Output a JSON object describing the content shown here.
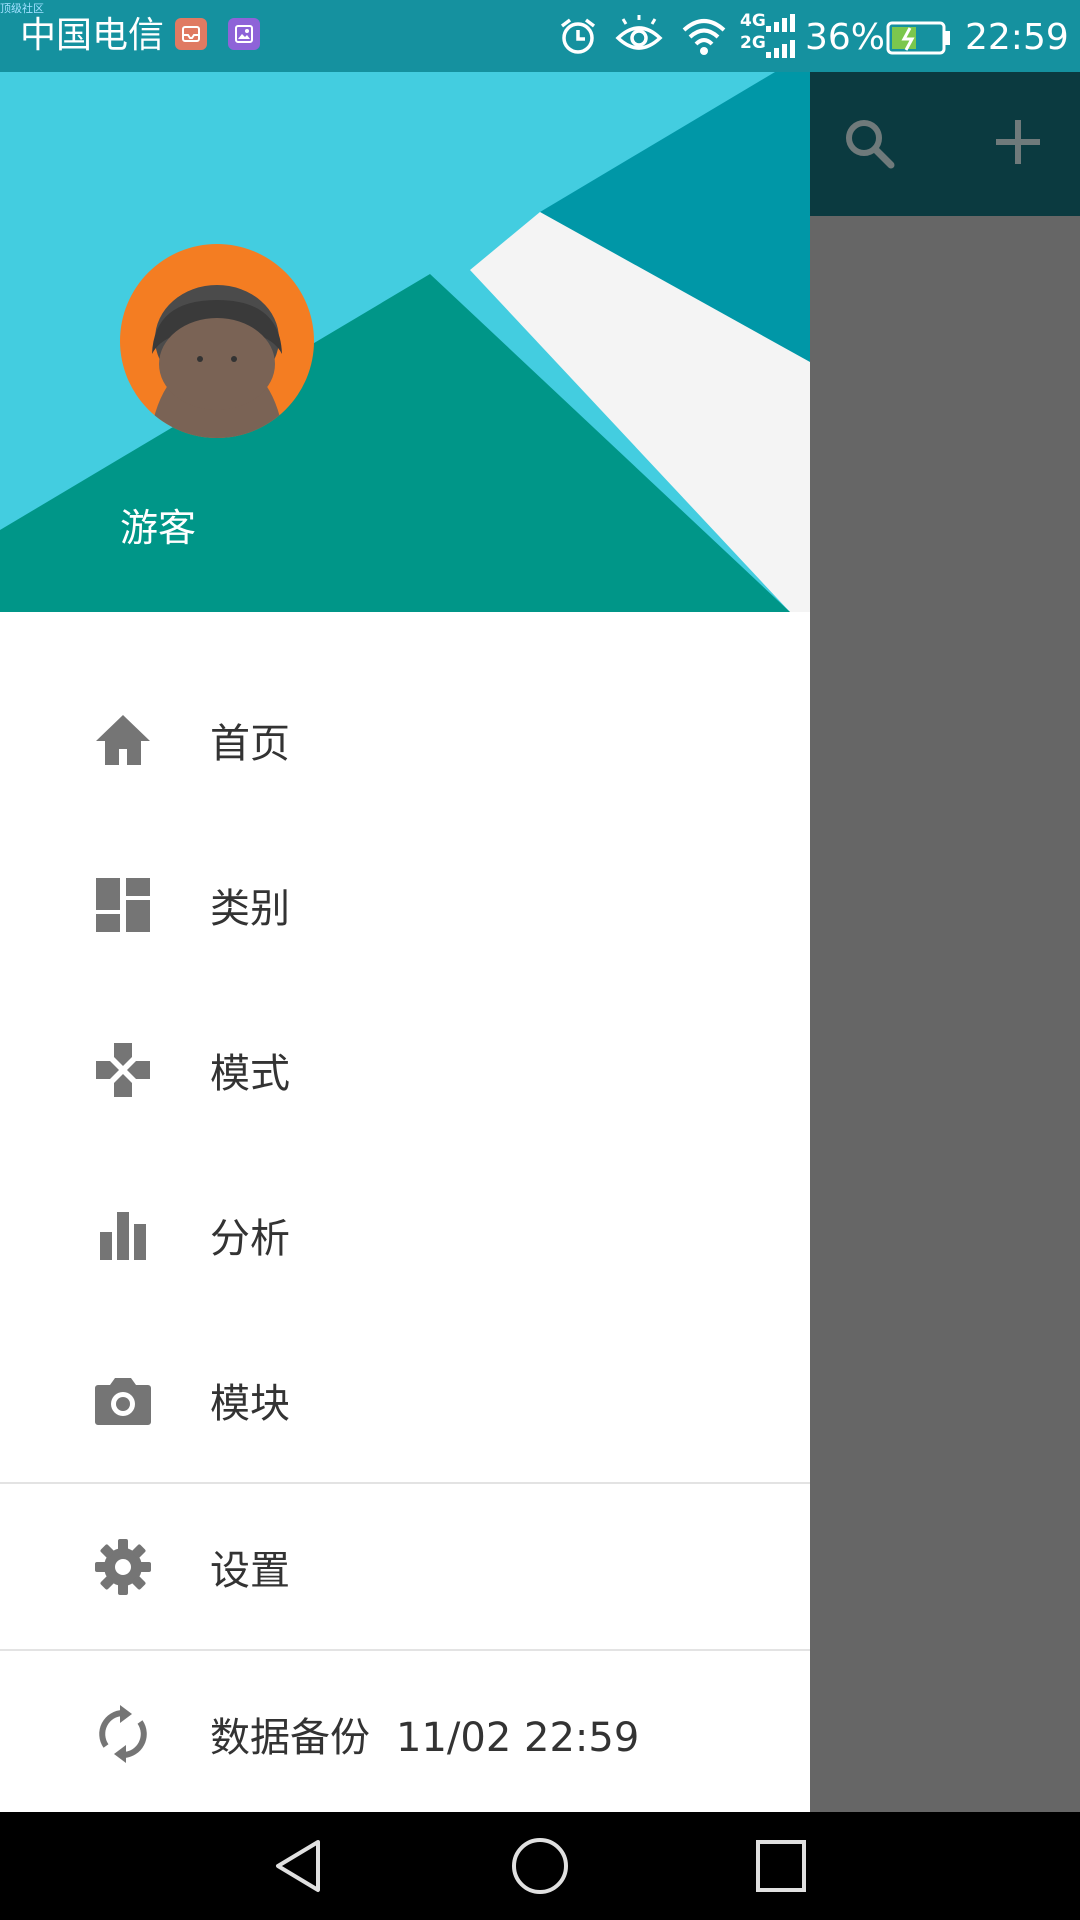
{
  "status_bar": {
    "tiny_tag": "顶级社区",
    "carrier": "中国电信",
    "network_top": "4G",
    "network_bottom": "2G",
    "battery_percent": "36%",
    "time": "22:59",
    "colors": {
      "background": "#15919f",
      "battery_fill": "#7bc74d"
    },
    "icons": [
      "mail-notification-icon",
      "gallery-notification-icon",
      "alarm-icon",
      "eye-comfort-icon",
      "wifi-icon",
      "signal-icon",
      "battery-charging-icon"
    ]
  },
  "app_toolbar": {
    "icons": [
      "search-icon",
      "add-icon"
    ]
  },
  "drawer": {
    "header": {
      "username": "游客",
      "colors": {
        "sky": "#43cde0",
        "teal": "#009688",
        "cyan_dark": "#0097a7",
        "white_band": "#f4f4f4",
        "avatar_ring": "#f47d22"
      }
    },
    "menu": [
      {
        "label": "首页",
        "icon": "home-icon"
      },
      {
        "label": "类别",
        "icon": "dashboard-icon"
      },
      {
        "label": "模式",
        "icon": "gamepad-icon"
      },
      {
        "label": "分析",
        "icon": "bar-chart-icon"
      },
      {
        "label": "模块",
        "icon": "camera-icon"
      }
    ],
    "settings": {
      "label": "设置",
      "icon": "settings-gear-icon"
    },
    "backup": {
      "label": "数据备份",
      "time": "11/02 22:59",
      "icon": "sync-icon"
    },
    "colors": {
      "icon": "#757575",
      "text": "#333333"
    }
  },
  "nav_bar": {
    "buttons": [
      "back-icon",
      "home-circle-icon",
      "recents-icon"
    ]
  }
}
